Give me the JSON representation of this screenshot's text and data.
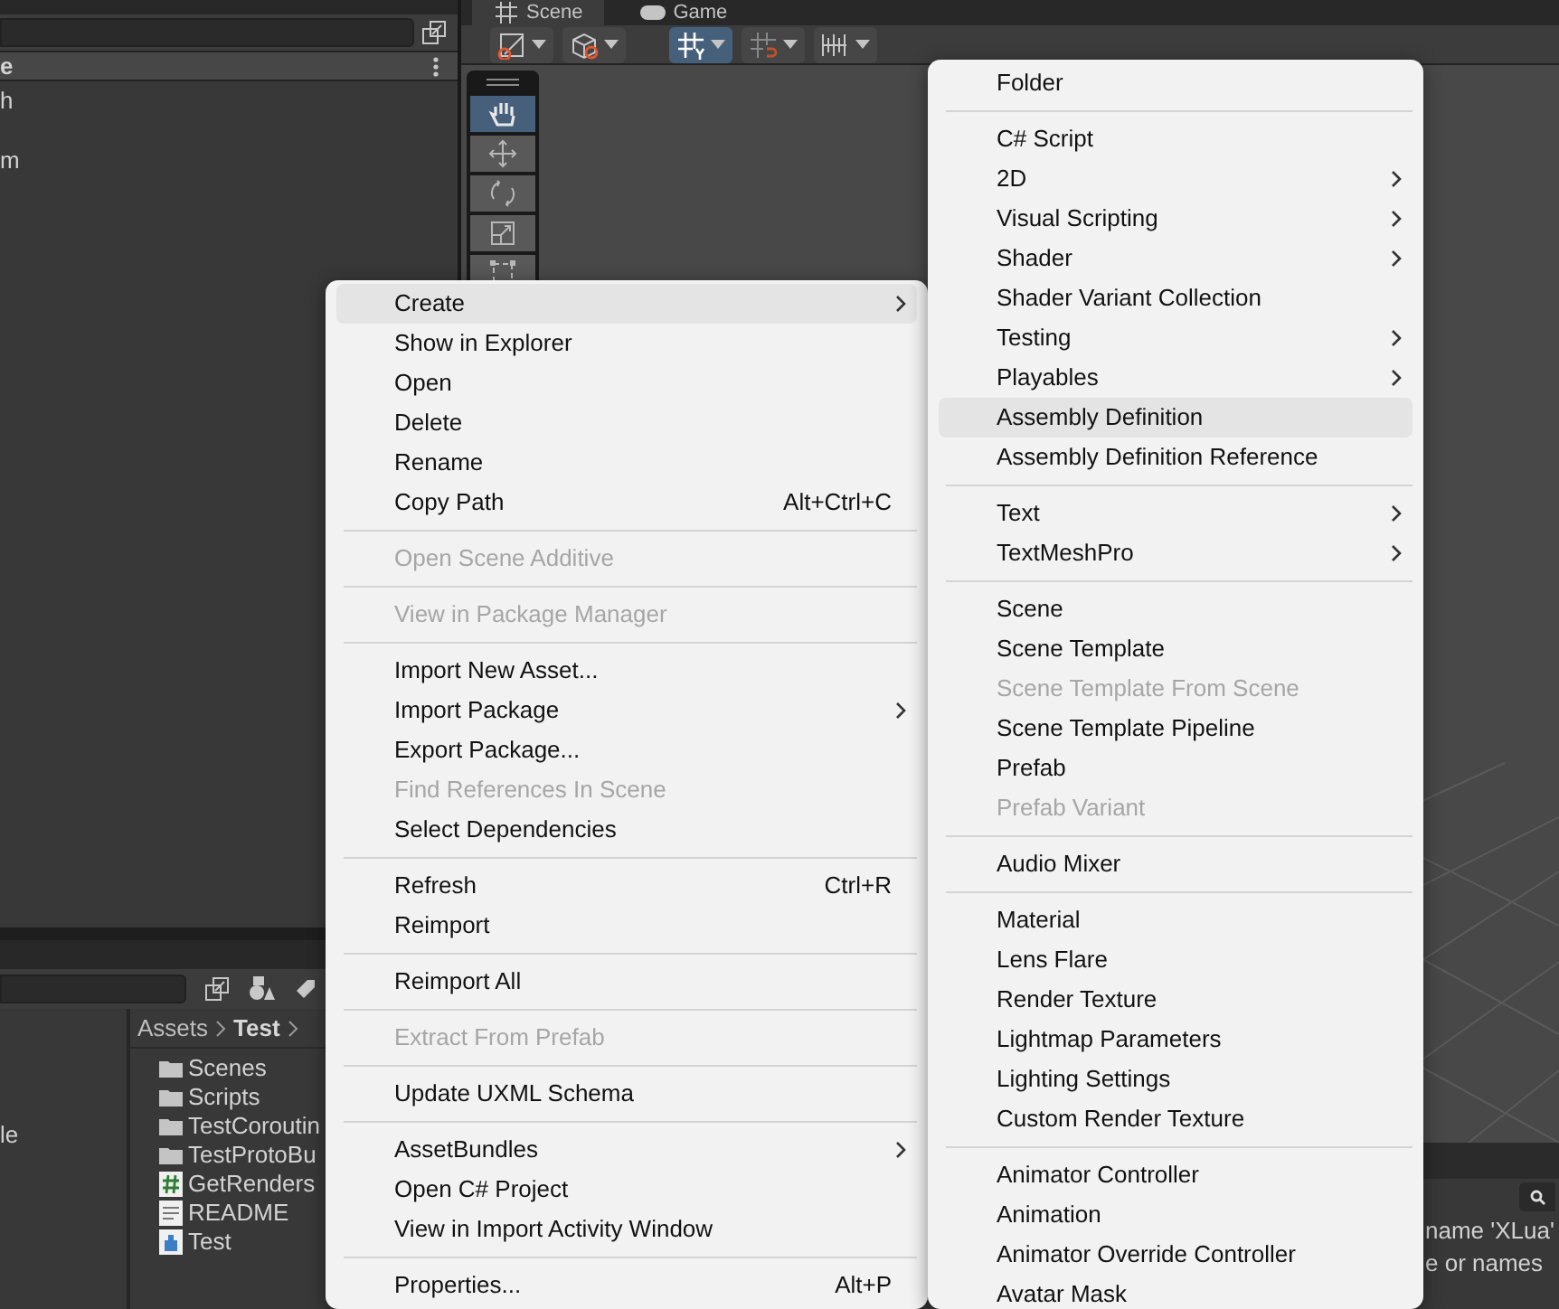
{
  "hierarchy": {
    "header": "e",
    "rows": [
      "h",
      "m"
    ]
  },
  "scene_tabs": [
    {
      "label": "Scene",
      "selected": true,
      "kind": "scene"
    },
    {
      "label": "Game",
      "selected": false,
      "kind": "game"
    }
  ],
  "scene_toolbar": [
    {
      "kind": "rect",
      "on": false
    },
    {
      "kind": "cube",
      "on": false
    },
    {
      "kind": "grid",
      "on": true
    },
    {
      "kind": "snap",
      "on": false
    },
    {
      "kind": "increment",
      "on": false
    }
  ],
  "tool_palette": [
    {
      "kind": "hand",
      "selected": true
    },
    {
      "kind": "move",
      "selected": false
    },
    {
      "kind": "rotate",
      "selected": false
    },
    {
      "kind": "scale",
      "selected": false
    },
    {
      "kind": "rect",
      "selected": false
    }
  ],
  "project": {
    "tree_rows": [
      "le"
    ],
    "breadcrumb": [
      "Assets",
      "Test"
    ],
    "items": [
      {
        "kind": "folder",
        "label": "Scenes"
      },
      {
        "kind": "folder",
        "label": "Scripts"
      },
      {
        "kind": "folder",
        "label": "TestCoroutin"
      },
      {
        "kind": "folder",
        "label": "TestProtoBu"
      },
      {
        "kind": "script",
        "label": "GetRenders"
      },
      {
        "kind": "text",
        "label": "README"
      },
      {
        "kind": "asset",
        "label": "Test"
      }
    ]
  },
  "console": {
    "lines": [
      "name 'XLua'",
      "e or names"
    ]
  },
  "context_menu": [
    {
      "kind": "item",
      "label": "Create",
      "submenu": true,
      "disabled": false,
      "selected": true
    },
    {
      "kind": "item",
      "label": "Show in Explorer",
      "submenu": false,
      "disabled": false,
      "selected": false
    },
    {
      "kind": "item",
      "label": "Open",
      "submenu": false,
      "disabled": false,
      "selected": false
    },
    {
      "kind": "item",
      "label": "Delete",
      "submenu": false,
      "disabled": false,
      "selected": false
    },
    {
      "kind": "item",
      "label": "Rename",
      "submenu": false,
      "disabled": false,
      "selected": false
    },
    {
      "kind": "item",
      "label": "Copy Path",
      "shortcut": "Alt+Ctrl+C",
      "submenu": false,
      "disabled": false,
      "selected": false
    },
    {
      "kind": "separator"
    },
    {
      "kind": "item",
      "label": "Open Scene Additive",
      "submenu": false,
      "disabled": true,
      "selected": false
    },
    {
      "kind": "separator"
    },
    {
      "kind": "item",
      "label": "View in Package Manager",
      "submenu": false,
      "disabled": true,
      "selected": false
    },
    {
      "kind": "separator"
    },
    {
      "kind": "item",
      "label": "Import New Asset...",
      "submenu": false,
      "disabled": false,
      "selected": false
    },
    {
      "kind": "item",
      "label": "Import Package",
      "submenu": true,
      "disabled": false,
      "selected": false
    },
    {
      "kind": "item",
      "label": "Export Package...",
      "submenu": false,
      "disabled": false,
      "selected": false
    },
    {
      "kind": "item",
      "label": "Find References In Scene",
      "submenu": false,
      "disabled": true,
      "selected": false
    },
    {
      "kind": "item",
      "label": "Select Dependencies",
      "submenu": false,
      "disabled": false,
      "selected": false
    },
    {
      "kind": "separator"
    },
    {
      "kind": "item",
      "label": "Refresh",
      "shortcut": "Ctrl+R",
      "submenu": false,
      "disabled": false,
      "selected": false
    },
    {
      "kind": "item",
      "label": "Reimport",
      "submenu": false,
      "disabled": false,
      "selected": false
    },
    {
      "kind": "separator"
    },
    {
      "kind": "item",
      "label": "Reimport All",
      "submenu": false,
      "disabled": false,
      "selected": false
    },
    {
      "kind": "separator"
    },
    {
      "kind": "item",
      "label": "Extract From Prefab",
      "submenu": false,
      "disabled": true,
      "selected": false
    },
    {
      "kind": "separator"
    },
    {
      "kind": "item",
      "label": "Update UXML Schema",
      "submenu": false,
      "disabled": false,
      "selected": false
    },
    {
      "kind": "separator"
    },
    {
      "kind": "item",
      "label": "AssetBundles",
      "submenu": true,
      "disabled": false,
      "selected": false
    },
    {
      "kind": "item",
      "label": "Open C# Project",
      "submenu": false,
      "disabled": false,
      "selected": false
    },
    {
      "kind": "item",
      "label": "View in Import Activity Window",
      "submenu": false,
      "disabled": false,
      "selected": false
    },
    {
      "kind": "separator"
    },
    {
      "kind": "item",
      "label": "Properties...",
      "shortcut": "Alt+P",
      "submenu": false,
      "disabled": false,
      "selected": false
    }
  ],
  "create_submenu": [
    {
      "kind": "item",
      "label": "Folder",
      "submenu": false,
      "disabled": false,
      "selected": false
    },
    {
      "kind": "separator"
    },
    {
      "kind": "item",
      "label": "C# Script",
      "submenu": false,
      "disabled": false,
      "selected": false
    },
    {
      "kind": "item",
      "label": "2D",
      "submenu": true,
      "disabled": false,
      "selected": false
    },
    {
      "kind": "item",
      "label": "Visual Scripting",
      "submenu": true,
      "disabled": false,
      "selected": false
    },
    {
      "kind": "item",
      "label": "Shader",
      "submenu": true,
      "disabled": false,
      "selected": false
    },
    {
      "kind": "item",
      "label": "Shader Variant Collection",
      "submenu": false,
      "disabled": false,
      "selected": false
    },
    {
      "kind": "item",
      "label": "Testing",
      "submenu": true,
      "disabled": false,
      "selected": false
    },
    {
      "kind": "item",
      "label": "Playables",
      "submenu": true,
      "disabled": false,
      "selected": false
    },
    {
      "kind": "item",
      "label": "Assembly Definition",
      "submenu": false,
      "disabled": false,
      "selected": true
    },
    {
      "kind": "item",
      "label": "Assembly Definition Reference",
      "submenu": false,
      "disabled": false,
      "selected": false
    },
    {
      "kind": "separator"
    },
    {
      "kind": "item",
      "label": "Text",
      "submenu": true,
      "disabled": false,
      "selected": false
    },
    {
      "kind": "item",
      "label": "TextMeshPro",
      "submenu": true,
      "disabled": false,
      "selected": false
    },
    {
      "kind": "separator"
    },
    {
      "kind": "item",
      "label": "Scene",
      "submenu": false,
      "disabled": false,
      "selected": false
    },
    {
      "kind": "item",
      "label": "Scene Template",
      "submenu": false,
      "disabled": false,
      "selected": false
    },
    {
      "kind": "item",
      "label": "Scene Template From Scene",
      "submenu": false,
      "disabled": true,
      "selected": false
    },
    {
      "kind": "item",
      "label": "Scene Template Pipeline",
      "submenu": false,
      "disabled": false,
      "selected": false
    },
    {
      "kind": "item",
      "label": "Prefab",
      "submenu": false,
      "disabled": false,
      "selected": false
    },
    {
      "kind": "item",
      "label": "Prefab Variant",
      "submenu": false,
      "disabled": true,
      "selected": false
    },
    {
      "kind": "separator"
    },
    {
      "kind": "item",
      "label": "Audio Mixer",
      "submenu": false,
      "disabled": false,
      "selected": false
    },
    {
      "kind": "separator"
    },
    {
      "kind": "item",
      "label": "Material",
      "submenu": false,
      "disabled": false,
      "selected": false
    },
    {
      "kind": "item",
      "label": "Lens Flare",
      "submenu": false,
      "disabled": false,
      "selected": false
    },
    {
      "kind": "item",
      "label": "Render Texture",
      "submenu": false,
      "disabled": false,
      "selected": false
    },
    {
      "kind": "item",
      "label": "Lightmap Parameters",
      "submenu": false,
      "disabled": false,
      "selected": false
    },
    {
      "kind": "item",
      "label": "Lighting Settings",
      "submenu": false,
      "disabled": false,
      "selected": false
    },
    {
      "kind": "item",
      "label": "Custom Render Texture",
      "submenu": false,
      "disabled": false,
      "selected": false
    },
    {
      "kind": "separator"
    },
    {
      "kind": "item",
      "label": "Animator Controller",
      "submenu": false,
      "disabled": false,
      "selected": false
    },
    {
      "kind": "item",
      "label": "Animation",
      "submenu": false,
      "disabled": false,
      "selected": false
    },
    {
      "kind": "item",
      "label": "Animator Override Controller",
      "submenu": false,
      "disabled": false,
      "selected": false
    },
    {
      "kind": "item",
      "label": "Avatar Mask",
      "submenu": false,
      "disabled": false,
      "selected": false
    }
  ]
}
